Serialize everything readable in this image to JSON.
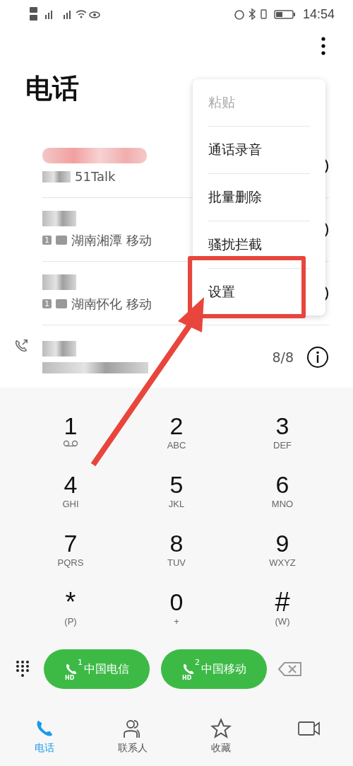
{
  "status_bar": {
    "time": "14:54"
  },
  "title": "电话",
  "calls": [
    {
      "detail": "51Talk",
      "outgoing": false
    },
    {
      "detail": "湖南湘潭 移动",
      "sim": "1",
      "outgoing": false
    },
    {
      "detail": "湖南怀化 移动",
      "sim": "1",
      "outgoing": false
    },
    {
      "outgoing": true,
      "count": "8/8"
    }
  ],
  "menu": [
    {
      "label": "粘贴",
      "disabled": true
    },
    {
      "label": "通话录音",
      "disabled": false
    },
    {
      "label": "批量删除",
      "disabled": false
    },
    {
      "label": "骚扰拦截",
      "disabled": false
    },
    {
      "label": "设置",
      "disabled": false
    }
  ],
  "keypad": [
    {
      "digit": "1",
      "kind": "voicemail"
    },
    {
      "digit": "2",
      "letters": "ABC",
      "kind": "letters"
    },
    {
      "digit": "3",
      "letters": "DEF",
      "kind": "letters"
    },
    {
      "digit": "4",
      "letters": "GHI",
      "kind": "letters"
    },
    {
      "digit": "5",
      "letters": "JKL",
      "kind": "letters"
    },
    {
      "digit": "6",
      "letters": "MNO",
      "kind": "letters"
    },
    {
      "digit": "7",
      "letters": "PQRS",
      "kind": "letters"
    },
    {
      "digit": "8",
      "letters": "TUV",
      "kind": "letters"
    },
    {
      "digit": "9",
      "letters": "WXYZ",
      "kind": "letters"
    },
    {
      "digit": "*",
      "letters": "(P)",
      "kind": "letters"
    },
    {
      "digit": "0",
      "letters": "+",
      "kind": "letters"
    },
    {
      "digit": "#",
      "letters": "(W)",
      "kind": "letters"
    }
  ],
  "call_buttons": [
    {
      "sim": "1",
      "hd": "HD",
      "label": "中国电信"
    },
    {
      "sim": "2",
      "hd": "HD",
      "label": "中国移动"
    }
  ],
  "nav": [
    {
      "label": "电话",
      "selected": true
    },
    {
      "label": "联系人",
      "selected": false
    },
    {
      "label": "收藏",
      "selected": false
    },
    {
      "selected": false
    }
  ]
}
